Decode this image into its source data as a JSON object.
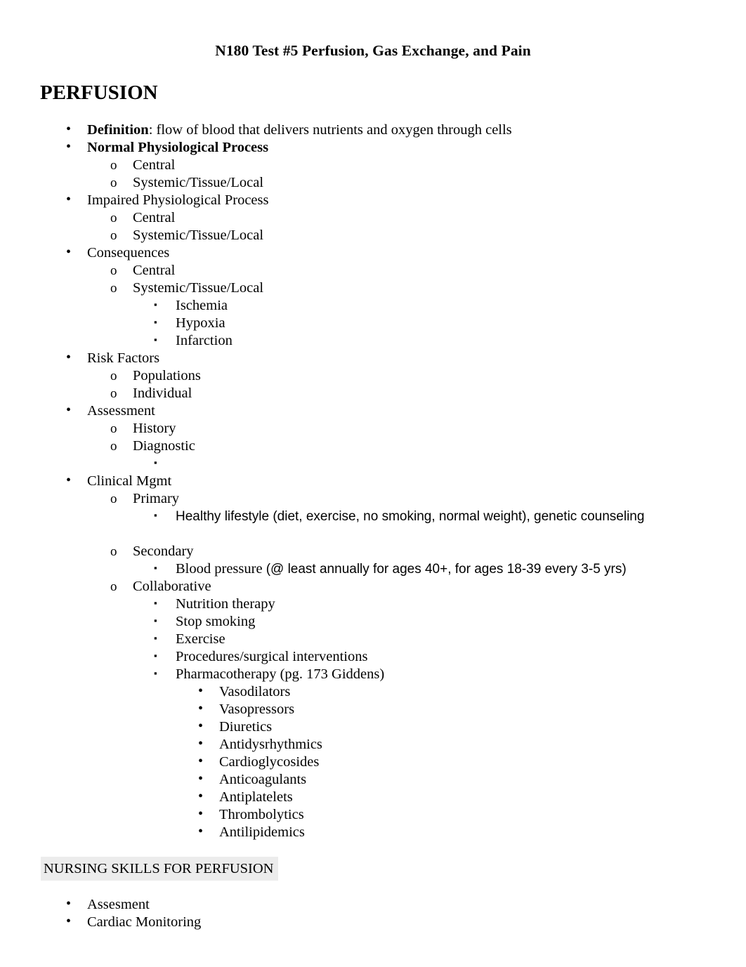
{
  "document": {
    "title": "N180 Test #5 Perfusion, Gas Exchange, and Pain",
    "section_heading": "PERFUSION",
    "skills_heading": "NURSING SKILLS FOR PERFUSION",
    "highlight_color": "#ececec"
  },
  "outline": [
    {
      "level": 1,
      "bullet": "•",
      "bold_prefix": "Definition",
      "rest": ": flow of blood that delivers nutrients and oxygen through cells"
    },
    {
      "level": 1,
      "bullet": "•",
      "text": "Normal Physiological Process",
      "bold": true
    },
    {
      "level": 2,
      "bullet": "o",
      "text": "Central"
    },
    {
      "level": 2,
      "bullet": "o",
      "text": "Systemic/Tissue/Local"
    },
    {
      "level": 1,
      "bullet": "•",
      "text": "Impaired Physiological Process"
    },
    {
      "level": 2,
      "bullet": "o",
      "text": "Central"
    },
    {
      "level": 2,
      "bullet": "o",
      "text": "Systemic/Tissue/Local"
    },
    {
      "level": 1,
      "bullet": "•",
      "text": "Consequences"
    },
    {
      "level": 2,
      "bullet": "o",
      "text": "Central"
    },
    {
      "level": 2,
      "bullet": "o",
      "text": "Systemic/Tissue/Local"
    },
    {
      "level": 3,
      "bullet": "▪",
      "text": "Ischemia"
    },
    {
      "level": 3,
      "bullet": "▪",
      "text": "Hypoxia"
    },
    {
      "level": 3,
      "bullet": "▪",
      "text": "Infarction"
    },
    {
      "level": 1,
      "bullet": "•",
      "text": "Risk Factors"
    },
    {
      "level": 2,
      "bullet": "o",
      "text": "Populations"
    },
    {
      "level": 2,
      "bullet": "o",
      "text": "Individual"
    },
    {
      "level": 1,
      "bullet": "•",
      "text": "Assessment"
    },
    {
      "level": 2,
      "bullet": "o",
      "text": "History"
    },
    {
      "level": 2,
      "bullet": "o",
      "text": "Diagnostic"
    },
    {
      "level": 3,
      "bullet": "▪",
      "text": ""
    },
    {
      "level": 1,
      "bullet": "•",
      "text": "Clinical Mgmt"
    },
    {
      "level": 2,
      "bullet": "o",
      "text": "Primary"
    },
    {
      "level": 3,
      "bullet": "▪",
      "text": "Healthy lifestyle (diet, exercise, no smoking, normal weight), genetic counseling",
      "font": "sans"
    },
    {
      "level": 2,
      "bullet": "o",
      "text": "Secondary",
      "space_before": true
    },
    {
      "level": 3,
      "bullet": "▪",
      "serif_prefix": "Blood pressure ",
      "sans_rest": "(@ least annually for ages 40+, for ages 18-39 every 3-5 yrs)"
    },
    {
      "level": 2,
      "bullet": "o",
      "text": "Collaborative"
    },
    {
      "level": 3,
      "bullet": "▪",
      "text": "Nutrition therapy"
    },
    {
      "level": 3,
      "bullet": "▪",
      "text": "Stop smoking"
    },
    {
      "level": 3,
      "bullet": "▪",
      "text": "Exercise"
    },
    {
      "level": 3,
      "bullet": "▪",
      "text": "Procedures/surgical interventions"
    },
    {
      "level": 3,
      "bullet": "▪",
      "text": "Pharmacotherapy (pg. 173 Giddens)"
    },
    {
      "level": 4,
      "bullet": "•",
      "text": "Vasodilators"
    },
    {
      "level": 4,
      "bullet": "•",
      "text": "Vasopressors"
    },
    {
      "level": 4,
      "bullet": "•",
      "text": "Diuretics"
    },
    {
      "level": 4,
      "bullet": "•",
      "text": "Antidysrhythmics"
    },
    {
      "level": 4,
      "bullet": "•",
      "text": "Cardioglycosides"
    },
    {
      "level": 4,
      "bullet": "•",
      "text": "Anticoagulants"
    },
    {
      "level": 4,
      "bullet": "•",
      "text": "Antiplatelets"
    },
    {
      "level": 4,
      "bullet": "•",
      "text": "Thrombolytics"
    },
    {
      "level": 4,
      "bullet": "•",
      "text": "Antilipidemics"
    }
  ],
  "tail_outline": [
    {
      "level": 1,
      "bullet": "•",
      "text": "Assesment"
    },
    {
      "level": 1,
      "bullet": "•",
      "text": "Cardiac Monitoring"
    }
  ]
}
